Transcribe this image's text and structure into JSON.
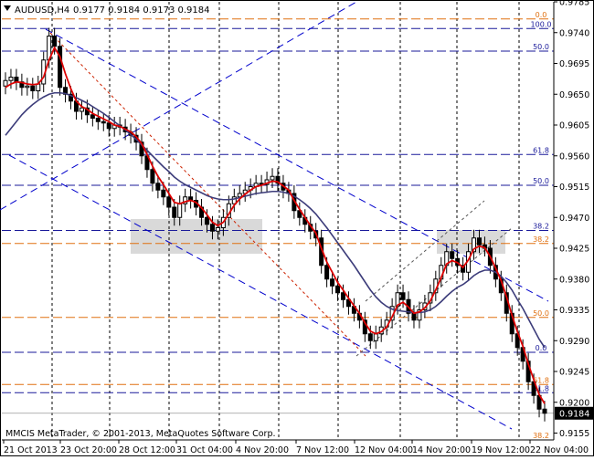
{
  "header": {
    "symbol_label": "AUDUSD,H4",
    "ohlc_label": "0.9177 0.9184 0.9173 0.9184"
  },
  "footer": {
    "copyright": "MMCIS MetaTrader, © 2001-2013, MetaQuotes Software Corp."
  },
  "colors": {
    "candle": "#000000",
    "ma_fast": "#dd0000",
    "ma_slow": "#3c3c7a",
    "fib_orange": "#e07010",
    "fib_blue": "#1a1a9a",
    "trend_blue": "#0000cc",
    "zone_gray": "#cccccc",
    "grid_black": "#000000"
  },
  "chart_data": {
    "type": "candlestick",
    "y_range": [
      0.9145,
      0.9785
    ],
    "price_ticks": [
      "0.9785",
      "0.9740",
      "0.9695",
      "0.9650",
      "0.9605",
      "0.9560",
      "0.9515",
      "0.9470",
      "0.9425",
      "0.9380",
      "0.9335",
      "0.9290",
      "0.9245",
      "0.9200",
      "0.9155"
    ],
    "current_price": "0.9184",
    "date_ticks": [
      "21 Oct 2013",
      "23 Oct 20:00",
      "28 Oct 12:00",
      "31 Oct 04:00",
      "4 Nov 20:00",
      "7 Nov 12:00",
      "12 Nov 04:00",
      "14 Nov 20:00",
      "19 Nov 12:00",
      "22 Nov 04:00"
    ],
    "period_separator_dates": [
      "23 Oct 20:00",
      "28 Oct 12:00",
      "31 Oct 04:00",
      "4 Nov 20:00",
      "7 Nov 12:00",
      "12 Nov 04:00",
      "14 Nov 20:00",
      "19 Nov 12:00"
    ],
    "close_series": [
      0.967,
      0.9675,
      0.9668,
      0.966,
      0.9662,
      0.9655,
      0.9665,
      0.97,
      0.9735,
      0.972,
      0.966,
      0.965,
      0.964,
      0.9625,
      0.963,
      0.962,
      0.9615,
      0.961,
      0.9608,
      0.96,
      0.9605,
      0.9602,
      0.9595,
      0.959,
      0.958,
      0.956,
      0.954,
      0.952,
      0.951,
      0.95,
      0.9485,
      0.947,
      0.949,
      0.95,
      0.9495,
      0.9485,
      0.947,
      0.946,
      0.945,
      0.9455,
      0.947,
      0.949,
      0.95,
      0.9505,
      0.951,
      0.9515,
      0.952,
      0.9518,
      0.9525,
      0.953,
      0.952,
      0.951,
      0.9505,
      0.948,
      0.947,
      0.946,
      0.945,
      0.944,
      0.94,
      0.938,
      0.937,
      0.936,
      0.935,
      0.934,
      0.933,
      0.932,
      0.93,
      0.929,
      0.93,
      0.931,
      0.932,
      0.934,
      0.936,
      0.935,
      0.933,
      0.932,
      0.9335,
      0.9345,
      0.936,
      0.938,
      0.94,
      0.942,
      0.941,
      0.94,
      0.939,
      0.942,
      0.944,
      0.943,
      0.9425,
      0.94,
      0.938,
      0.936,
      0.933,
      0.93,
      0.928,
      0.926,
      0.923,
      0.921,
      0.919,
      0.9184
    ],
    "ma_fast": [
      0.966,
      0.9665,
      0.9668,
      0.9667,
      0.9665,
      0.9664,
      0.9665,
      0.9675,
      0.97,
      0.9718,
      0.9705,
      0.968,
      0.9658,
      0.964,
      0.9632,
      0.9628,
      0.9622,
      0.9618,
      0.9614,
      0.961,
      0.9605,
      0.9603,
      0.9599,
      0.9595,
      0.9588,
      0.9578,
      0.9562,
      0.9545,
      0.953,
      0.9518,
      0.9505,
      0.9492,
      0.949,
      0.9493,
      0.9495,
      0.9492,
      0.9484,
      0.9474,
      0.9463,
      0.9458,
      0.9463,
      0.9475,
      0.9488,
      0.9497,
      0.9504,
      0.951,
      0.9515,
      0.9517,
      0.952,
      0.9523,
      0.9522,
      0.9516,
      0.951,
      0.9495,
      0.9482,
      0.947,
      0.9458,
      0.9447,
      0.9425,
      0.9405,
      0.939,
      0.9375,
      0.9364,
      0.9352,
      0.9341,
      0.933,
      0.9316,
      0.9304,
      0.93,
      0.9303,
      0.931,
      0.9325,
      0.9342,
      0.9346,
      0.9339,
      0.933,
      0.9332,
      0.9338,
      0.9348,
      0.9364,
      0.9382,
      0.9402,
      0.9407,
      0.9404,
      0.9397,
      0.9408,
      0.9424,
      0.9428,
      0.9426,
      0.9413,
      0.9396,
      0.9378,
      0.9354,
      0.9327,
      0.9303,
      0.9282,
      0.9256,
      0.9233,
      0.9211,
      0.9198
    ],
    "ma_slow": [
      0.959,
      0.96,
      0.961,
      0.962,
      0.9628,
      0.9635,
      0.9641,
      0.9646,
      0.965,
      0.9652,
      0.9652,
      0.9651,
      0.9648,
      0.9645,
      0.9641,
      0.9637,
      0.9632,
      0.9627,
      0.9622,
      0.9616,
      0.961,
      0.9604,
      0.9598,
      0.9591,
      0.9584,
      0.9576,
      0.9568,
      0.956,
      0.9552,
      0.9544,
      0.9537,
      0.9529,
      0.9523,
      0.9518,
      0.9514,
      0.951,
      0.9506,
      0.9502,
      0.9499,
      0.9497,
      0.9496,
      0.9496,
      0.9497,
      0.9499,
      0.9501,
      0.9503,
      0.9505,
      0.9506,
      0.9507,
      0.9508,
      0.9508,
      0.9507,
      0.9505,
      0.9501,
      0.9496,
      0.949,
      0.9483,
      0.9475,
      0.9465,
      0.9455,
      0.9444,
      0.9433,
      0.9422,
      0.9411,
      0.94,
      0.9388,
      0.9376,
      0.9364,
      0.9354,
      0.9346,
      0.934,
      0.9336,
      0.9334,
      0.9333,
      0.9332,
      0.9331,
      0.9331,
      0.9332,
      0.9335,
      0.934,
      0.9347,
      0.9355,
      0.9362,
      0.9368,
      0.9372,
      0.9378,
      0.9385,
      0.939,
      0.9393,
      0.9393,
      0.939,
      0.9384,
      0.9375,
      0.9364,
      0.935,
      0.9337,
      0.9322,
      0.9307,
      0.9292,
      0.928
    ],
    "fib_levels_left": [
      {
        "label": "0.0",
        "price": 0.976
      },
      {
        "label": "100.0",
        "price": 0.9746
      },
      {
        "label": "50.0",
        "price": 0.9713
      },
      {
        "label": "61.8",
        "price": 0.9562
      },
      {
        "label": "50.0",
        "price": 0.9517
      },
      {
        "label": "38.2",
        "price": 0.9451
      },
      {
        "label": "38.2",
        "price": 0.9432
      },
      {
        "label": "50.0",
        "price": 0.9324
      },
      {
        "label": "0.0",
        "price": 0.9273
      },
      {
        "label": "61.8",
        "price": 0.9226
      },
      {
        "label": "61.8",
        "price": 0.9214
      },
      {
        "label": "38.2",
        "price": 0.9145
      }
    ]
  }
}
